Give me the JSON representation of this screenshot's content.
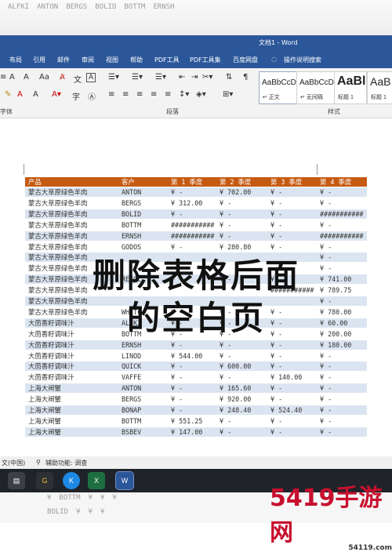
{
  "window": {
    "title": "文档1 - Word"
  },
  "ribbon_tabs": [
    "布局",
    "引用",
    "邮件",
    "审阅",
    "视图",
    "帮助",
    "PDF工具",
    "PDF工具集",
    "百度网盘",
    "操作说明搜索"
  ],
  "ribbon": {
    "group_font": "字体",
    "group_paragraph": "段落",
    "group_styles": "样式",
    "styles": [
      {
        "sample": "AaBbCcDc",
        "name": "↵ 正文"
      },
      {
        "sample": "AaBbCcDc",
        "name": "↵ 无间隔"
      },
      {
        "sample": "AaBl",
        "name": "标题 1"
      },
      {
        "sample": "AaB",
        "name": "标题 1"
      }
    ]
  },
  "table": {
    "headers": [
      "产品",
      "客户",
      "第 1 季度",
      "第 2 季度",
      "第 3 季度",
      "第 4 季度"
    ],
    "rows": [
      [
        "蒙古大草原绿色羊肉",
        "ANTON",
        "¥    -",
        "¥ 702.00",
        "¥    -",
        "¥    -"
      ],
      [
        "蒙古大草原绿色羊肉",
        "BERGS",
        "¥ 312.00",
        "¥    -",
        "¥    -",
        "¥    -"
      ],
      [
        "蒙古大草原绿色羊肉",
        "BOLID",
        "¥    -",
        "¥    -",
        "¥    -",
        "###########"
      ],
      [
        "蒙古大草原绿色羊肉",
        "BOTTM",
        "###########",
        "¥    -",
        "¥    -",
        "¥    -"
      ],
      [
        "蒙古大草原绿色羊肉",
        "ERNSH",
        "###########",
        "¥    -",
        "¥    -",
        "###########"
      ],
      [
        "蒙古大草原绿色羊肉",
        "GODOS",
        "¥    -",
        "¥ 280.80",
        "¥    -",
        "¥    -"
      ],
      [
        "蒙古大草原绿色羊肉",
        "",
        "",
        "",
        "",
        "¥    -"
      ],
      [
        "蒙古大草原绿色羊肉",
        "",
        "",
        "",
        "",
        "¥    -"
      ],
      [
        "蒙古大草原绿色羊肉",
        "REGGC",
        "¥    -",
        "¥    -",
        "¥    -",
        "¥ 741.00"
      ],
      [
        "蒙古大草原绿色羊肉",
        "",
        "",
        "",
        "###########",
        "¥ 789.75"
      ],
      [
        "蒙古大草原绿色羊肉",
        "",
        "",
        "",
        "",
        "¥    -"
      ],
      [
        "蒙古大草原绿色羊肉",
        "WHITC",
        "¥    -",
        "¥    -",
        "¥    -",
        "¥ 780.00"
      ],
      [
        "大茴香籽调味汁",
        "ALFKI",
        "¥    -",
        "¥    -",
        "¥    -",
        "¥  60.00"
      ],
      [
        "大茴香籽调味汁",
        "BOTTM",
        "¥    -",
        "¥    -",
        "¥    -",
        "¥ 200.00"
      ],
      [
        "大茴香籽调味汁",
        "ERNSH",
        "¥    -",
        "¥    -",
        "¥    -",
        "¥ 180.00"
      ],
      [
        "大茴香籽调味汁",
        "LINOD",
        "¥ 544.00",
        "¥    -",
        "¥    -",
        "¥    -"
      ],
      [
        "大茴香籽调味汁",
        "QUICK",
        "¥    -",
        "¥ 600.00",
        "¥    -",
        "¥    -"
      ],
      [
        "大茴香籽调味汁",
        "VAFFE",
        "¥    -",
        "¥    -",
        "¥ 140.00",
        "¥    -"
      ],
      [
        "上海大闸蟹",
        "ANTON",
        "¥    -",
        "¥ 165.60",
        "¥    -",
        "¥    -"
      ],
      [
        "上海大闸蟹",
        "BERGS",
        "¥    -",
        "¥ 920.00",
        "¥    -",
        "¥    -"
      ],
      [
        "上海大闸蟹",
        "BONAP",
        "¥    -",
        "¥ 248.40",
        "¥ 524.40",
        "¥    -"
      ],
      [
        "上海大闸蟹",
        "BOTTM",
        "¥ 551.25",
        "¥    -",
        "¥    -",
        "¥    -"
      ],
      [
        "上海大闸蟹",
        "BSBEV",
        "¥ 147.00",
        "¥    -",
        "¥    -",
        "¥    -"
      ]
    ]
  },
  "overlay": {
    "line1": "删除表格后面",
    "line2": "的空白页"
  },
  "status_bar": {
    "lang": "文(中国)",
    "accessibility": "辅助功能: 调查"
  },
  "taskbar": {
    "apps": [
      "G",
      "K",
      "X",
      "W"
    ]
  },
  "watermark": {
    "logo": "5419手游网",
    "site": "54119.com"
  }
}
